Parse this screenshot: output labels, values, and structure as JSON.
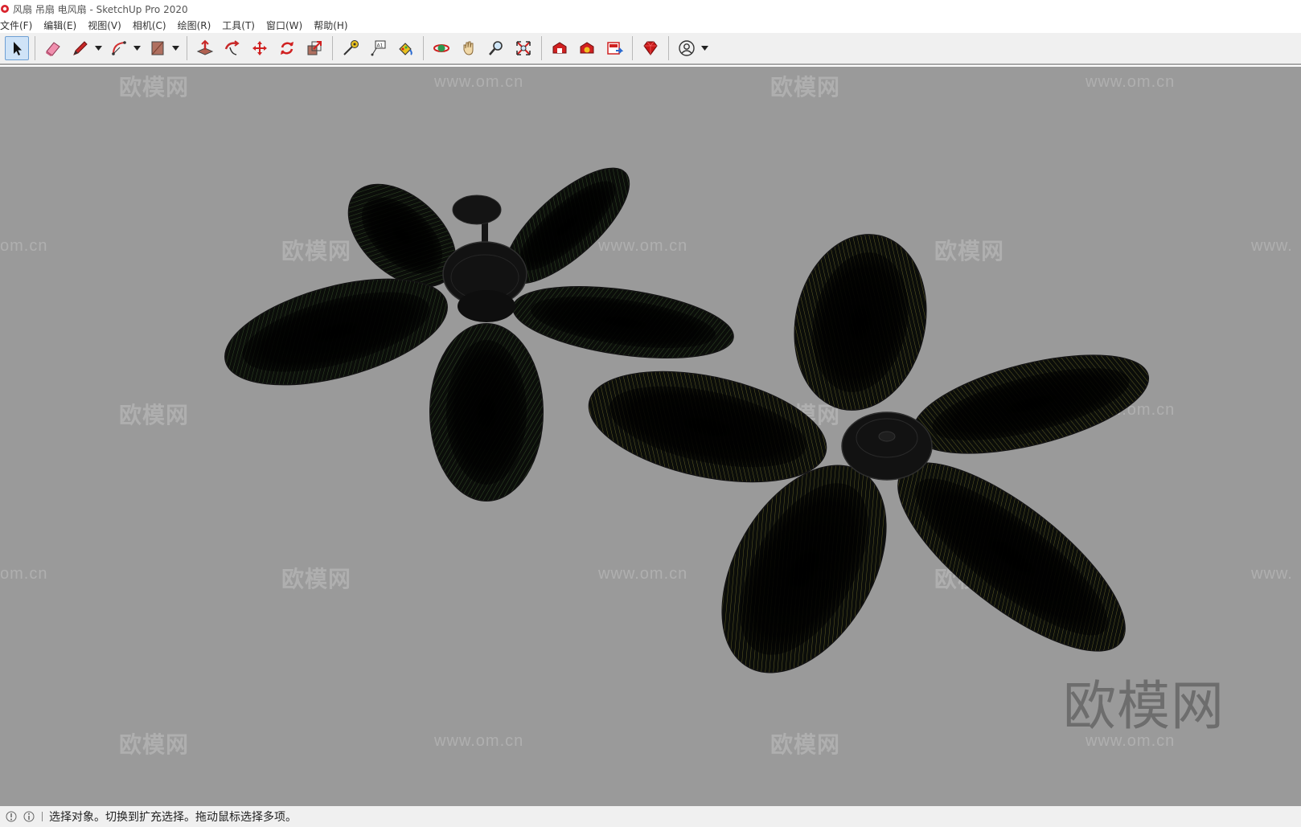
{
  "window": {
    "title": "风扇 吊扇 电风扇 - SketchUp Pro 2020"
  },
  "menu": [
    {
      "label": "文件(F)"
    },
    {
      "label": "编辑(E)"
    },
    {
      "label": "视图(V)"
    },
    {
      "label": "相机(C)"
    },
    {
      "label": "绘图(R)"
    },
    {
      "label": "工具(T)"
    },
    {
      "label": "窗口(W)"
    },
    {
      "label": "帮助(H)"
    }
  ],
  "toolbar": {
    "tools": [
      "select-icon",
      "eraser-icon",
      "pencil-icon",
      "arc-icon",
      "rectangle-icon",
      "push-pull-icon",
      "follow-me-icon",
      "move-icon",
      "rotate-icon",
      "scale-icon",
      "tape-measure-icon",
      "text-icon",
      "paint-bucket-icon",
      "orbit-icon",
      "pan-icon",
      "zoom-icon",
      "zoom-extents-icon",
      "warehouse-icon",
      "extension-warehouse-icon",
      "layout-icon",
      "ruby-icon",
      "account-icon"
    ]
  },
  "viewport": {
    "watermarks_small": [
      "欧模网",
      "www.om.cn",
      "om.cn",
      "www."
    ],
    "watermark_big": "欧模网"
  },
  "status": {
    "text": "选择对象。切换到扩充选择。拖动鼠标选择多项。"
  },
  "colors": {
    "viewport_bg": "#9a9a9a",
    "fan_left_tint": "#4a7a3a",
    "fan_right_tint": "#a8a038"
  }
}
